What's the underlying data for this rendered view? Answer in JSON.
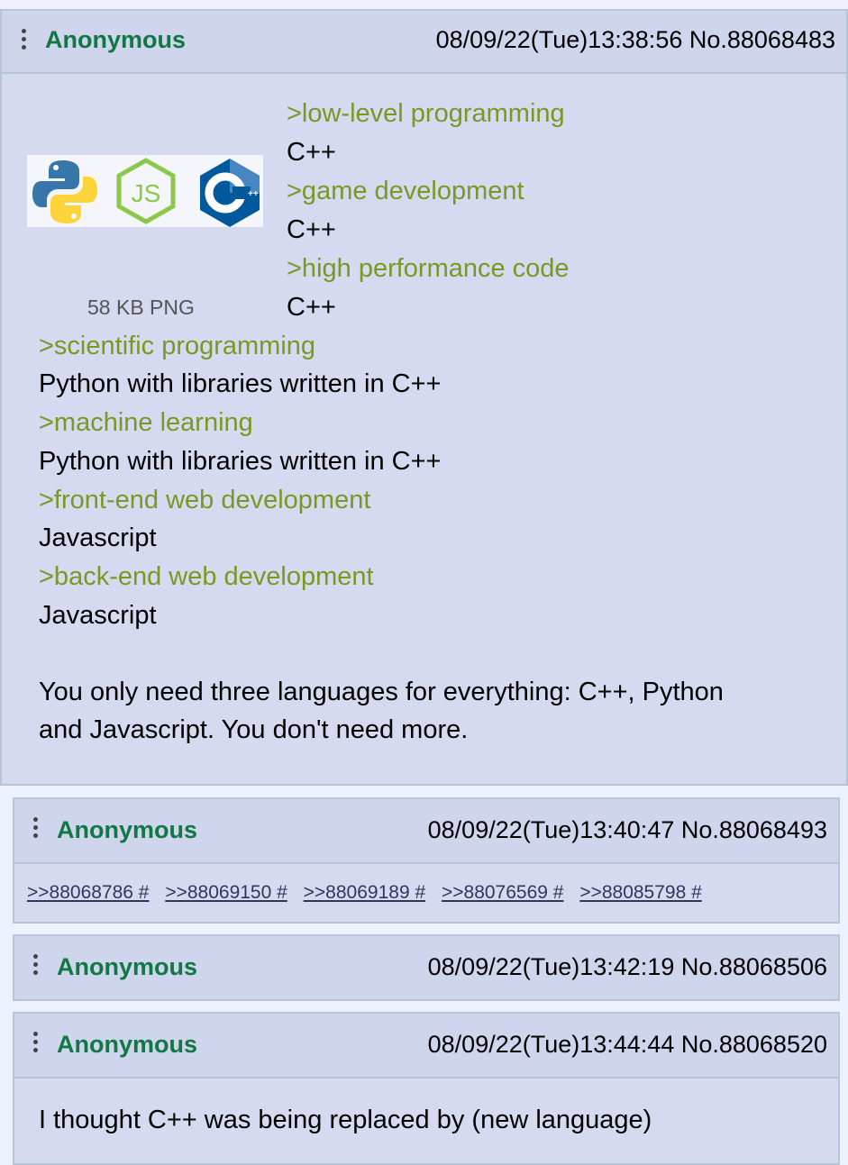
{
  "posts": [
    {
      "name": "Anonymous",
      "meta": "08/09/22(Tue)13:38:56 No.88068483",
      "file_info": "58 KB PNG",
      "thumb_icons": [
        "python-logo-icon",
        "nodejs-logo-icon",
        "cpp-logo-icon"
      ],
      "lines": [
        ">low-level programming",
        "C++",
        ">game development",
        "C++",
        ">high performance code",
        "C++",
        ">scientific programming",
        "Python with libraries written in C++",
        ">machine learning",
        "Python with libraries written in C++",
        ">front-end web development",
        "Javascript",
        ">back-end web development",
        "Javascript",
        "You only need three languages for everything: C++, Python",
        "and Javascript. You don't need more."
      ]
    },
    {
      "name": "Anonymous",
      "meta": "08/09/22(Tue)13:40:47 No.88068493",
      "backlinks": [
        ">>88068786 #",
        ">>88069150 #",
        ">>88069189 #",
        ">>88076569 #",
        ">>88085798 #"
      ]
    },
    {
      "name": "Anonymous",
      "meta": "08/09/22(Tue)13:42:19 No.88068506"
    },
    {
      "name": "Anonymous",
      "meta": "08/09/22(Tue)13:44:44 No.88068520",
      "lines": [
        "I thought C++ was being replaced by (new language)"
      ]
    }
  ],
  "colors": {
    "post_bg": "#d6daf0",
    "border": "#b7c5d9",
    "name": "#117743",
    "greentext": "#789922",
    "link": "#34345c",
    "page_bg": "#eef2ff"
  }
}
